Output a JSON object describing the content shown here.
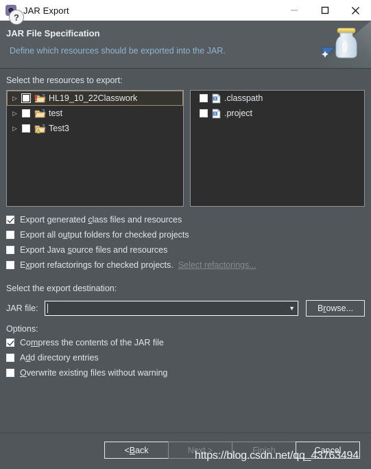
{
  "window": {
    "title": "JAR Export",
    "icon": "jar-export-icon",
    "controls": {
      "minimize": "minimize-icon",
      "maximize": "maximize-icon",
      "close": "close-icon"
    }
  },
  "header": {
    "title": "JAR File Specification",
    "subtitle": "Define which resources should be exported into the JAR.",
    "art": "jar-bottle-icon"
  },
  "resources": {
    "label": "Select the resources to export:",
    "tree": [
      {
        "name": "HL19_10_22Classwork",
        "checked": false,
        "selected": true,
        "expandable": true,
        "icon": "project-folder-error-icon"
      },
      {
        "name": "test",
        "checked": false,
        "selected": false,
        "expandable": true,
        "icon": "project-folder-icon"
      },
      {
        "name": "Test3",
        "checked": false,
        "selected": false,
        "expandable": true,
        "icon": "project-folder-warning-icon"
      }
    ],
    "files": [
      {
        "name": ".classpath",
        "checked": false,
        "icon": "xml-file-icon"
      },
      {
        "name": ".project",
        "checked": false,
        "icon": "xml-file-icon"
      }
    ]
  },
  "export_options": [
    {
      "pre": "Export generated ",
      "mnemonic": "c",
      "post": "lass files and resources",
      "checked": true
    },
    {
      "pre": "Export all o",
      "mnemonic": "u",
      "post": "tput folders for checked projects",
      "checked": false
    },
    {
      "pre": "Export Java ",
      "mnemonic": "s",
      "post": "ource files and resources",
      "checked": false
    },
    {
      "pre": "E",
      "mnemonic": "x",
      "post": "port refactorings for checked projects.",
      "checked": false,
      "link": "Select refactorings..."
    }
  ],
  "destination": {
    "label": "Select the export destination:",
    "jar_file_label": "JAR file:",
    "jar_file_value": "",
    "jar_file_placeholder": "",
    "browse": {
      "pre": "B",
      "mnemonic": "r",
      "post": "owse..."
    }
  },
  "options": {
    "label": "Options:",
    "items": [
      {
        "pre": "Co",
        "mnemonic": "m",
        "post": "press the contents of the JAR file",
        "checked": true
      },
      {
        "pre": "A",
        "mnemonic": "d",
        "post": "d directory entries",
        "checked": false
      },
      {
        "pre": "",
        "mnemonic": "O",
        "post": "verwrite existing files without warning",
        "checked": false
      }
    ]
  },
  "footer": {
    "help": "?",
    "buttons": [
      {
        "pre": "< ",
        "mnemonic": "B",
        "post": "ack",
        "enabled": true
      },
      {
        "pre": "",
        "mnemonic": "N",
        "post": "ext >",
        "enabled": false
      },
      {
        "pre": "",
        "mnemonic": "F",
        "post": "inish",
        "enabled": false
      },
      {
        "pre": "",
        "mnemonic": "C",
        "post": "ancel",
        "enabled": true
      }
    ],
    "watermark": "https://blog.csdn.net/qq_43763494"
  }
}
